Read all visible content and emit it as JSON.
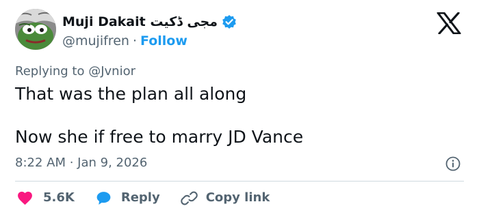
{
  "author": {
    "display_name": "Muji Dakait مجی ڈکیت",
    "handle": "@mujifren",
    "separator": "·",
    "follow_label": "Follow"
  },
  "tweet": {
    "replying_to": "Replying to @Jvnior",
    "line1": "That was the plan all along",
    "line2": "Now she if free to marry JD Vance",
    "timestamp": "8:22 AM · Jan 9, 2026"
  },
  "actions": {
    "like_count": "5.6K",
    "reply_label": "Reply",
    "copy_label": "Copy link"
  },
  "colors": {
    "accent_blue": "#1d9bf0",
    "like_red": "#f91880",
    "muted_text": "#536471",
    "text": "#0f1419",
    "divider": "#cfd9de"
  },
  "icons": {
    "avatar": "pepe-frog-avatar",
    "verified": "verified-badge-icon",
    "brand": "x-logo-icon",
    "info": "info-icon",
    "like": "heart-icon",
    "reply": "speech-bubble-icon",
    "copy": "link-icon"
  }
}
